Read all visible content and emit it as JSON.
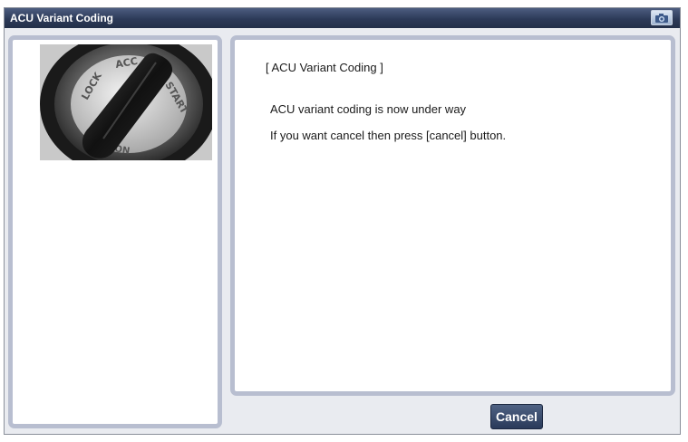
{
  "window": {
    "title": "ACU Variant Coding",
    "camera_button": {
      "icon": "camera-icon"
    }
  },
  "left_panel": {
    "image": {
      "subject": "ignition key switch",
      "position_labels": [
        "LOCK",
        "ACC",
        "START",
        "ON"
      ]
    }
  },
  "right_panel": {
    "heading": "[ ACU Variant Coding ]",
    "lines": [
      "ACU variant coding is now under way",
      "If you want cancel then press [cancel] button."
    ]
  },
  "buttons": {
    "cancel_label": "Cancel"
  },
  "colors": {
    "titlebar": "#2c3a58",
    "panel_border": "#b8bed0",
    "button": "#3a4b6d"
  }
}
